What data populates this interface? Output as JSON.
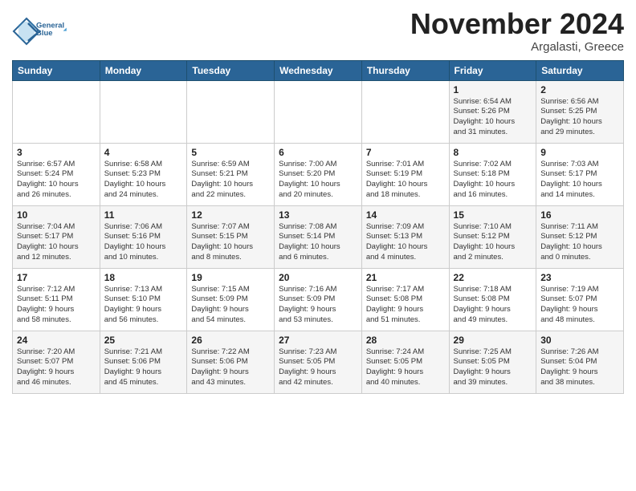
{
  "header": {
    "logo_line1": "General",
    "logo_line2": "Blue",
    "month": "November 2024",
    "location": "Argalasti, Greece"
  },
  "weekdays": [
    "Sunday",
    "Monday",
    "Tuesday",
    "Wednesday",
    "Thursday",
    "Friday",
    "Saturday"
  ],
  "weeks": [
    [
      {
        "day": "",
        "info": ""
      },
      {
        "day": "",
        "info": ""
      },
      {
        "day": "",
        "info": ""
      },
      {
        "day": "",
        "info": ""
      },
      {
        "day": "",
        "info": ""
      },
      {
        "day": "1",
        "info": "Sunrise: 6:54 AM\nSunset: 5:26 PM\nDaylight: 10 hours\nand 31 minutes."
      },
      {
        "day": "2",
        "info": "Sunrise: 6:56 AM\nSunset: 5:25 PM\nDaylight: 10 hours\nand 29 minutes."
      }
    ],
    [
      {
        "day": "3",
        "info": "Sunrise: 6:57 AM\nSunset: 5:24 PM\nDaylight: 10 hours\nand 26 minutes."
      },
      {
        "day": "4",
        "info": "Sunrise: 6:58 AM\nSunset: 5:23 PM\nDaylight: 10 hours\nand 24 minutes."
      },
      {
        "day": "5",
        "info": "Sunrise: 6:59 AM\nSunset: 5:21 PM\nDaylight: 10 hours\nand 22 minutes."
      },
      {
        "day": "6",
        "info": "Sunrise: 7:00 AM\nSunset: 5:20 PM\nDaylight: 10 hours\nand 20 minutes."
      },
      {
        "day": "7",
        "info": "Sunrise: 7:01 AM\nSunset: 5:19 PM\nDaylight: 10 hours\nand 18 minutes."
      },
      {
        "day": "8",
        "info": "Sunrise: 7:02 AM\nSunset: 5:18 PM\nDaylight: 10 hours\nand 16 minutes."
      },
      {
        "day": "9",
        "info": "Sunrise: 7:03 AM\nSunset: 5:17 PM\nDaylight: 10 hours\nand 14 minutes."
      }
    ],
    [
      {
        "day": "10",
        "info": "Sunrise: 7:04 AM\nSunset: 5:17 PM\nDaylight: 10 hours\nand 12 minutes."
      },
      {
        "day": "11",
        "info": "Sunrise: 7:06 AM\nSunset: 5:16 PM\nDaylight: 10 hours\nand 10 minutes."
      },
      {
        "day": "12",
        "info": "Sunrise: 7:07 AM\nSunset: 5:15 PM\nDaylight: 10 hours\nand 8 minutes."
      },
      {
        "day": "13",
        "info": "Sunrise: 7:08 AM\nSunset: 5:14 PM\nDaylight: 10 hours\nand 6 minutes."
      },
      {
        "day": "14",
        "info": "Sunrise: 7:09 AM\nSunset: 5:13 PM\nDaylight: 10 hours\nand 4 minutes."
      },
      {
        "day": "15",
        "info": "Sunrise: 7:10 AM\nSunset: 5:12 PM\nDaylight: 10 hours\nand 2 minutes."
      },
      {
        "day": "16",
        "info": "Sunrise: 7:11 AM\nSunset: 5:12 PM\nDaylight: 10 hours\nand 0 minutes."
      }
    ],
    [
      {
        "day": "17",
        "info": "Sunrise: 7:12 AM\nSunset: 5:11 PM\nDaylight: 9 hours\nand 58 minutes."
      },
      {
        "day": "18",
        "info": "Sunrise: 7:13 AM\nSunset: 5:10 PM\nDaylight: 9 hours\nand 56 minutes."
      },
      {
        "day": "19",
        "info": "Sunrise: 7:15 AM\nSunset: 5:09 PM\nDaylight: 9 hours\nand 54 minutes."
      },
      {
        "day": "20",
        "info": "Sunrise: 7:16 AM\nSunset: 5:09 PM\nDaylight: 9 hours\nand 53 minutes."
      },
      {
        "day": "21",
        "info": "Sunrise: 7:17 AM\nSunset: 5:08 PM\nDaylight: 9 hours\nand 51 minutes."
      },
      {
        "day": "22",
        "info": "Sunrise: 7:18 AM\nSunset: 5:08 PM\nDaylight: 9 hours\nand 49 minutes."
      },
      {
        "day": "23",
        "info": "Sunrise: 7:19 AM\nSunset: 5:07 PM\nDaylight: 9 hours\nand 48 minutes."
      }
    ],
    [
      {
        "day": "24",
        "info": "Sunrise: 7:20 AM\nSunset: 5:07 PM\nDaylight: 9 hours\nand 46 minutes."
      },
      {
        "day": "25",
        "info": "Sunrise: 7:21 AM\nSunset: 5:06 PM\nDaylight: 9 hours\nand 45 minutes."
      },
      {
        "day": "26",
        "info": "Sunrise: 7:22 AM\nSunset: 5:06 PM\nDaylight: 9 hours\nand 43 minutes."
      },
      {
        "day": "27",
        "info": "Sunrise: 7:23 AM\nSunset: 5:05 PM\nDaylight: 9 hours\nand 42 minutes."
      },
      {
        "day": "28",
        "info": "Sunrise: 7:24 AM\nSunset: 5:05 PM\nDaylight: 9 hours\nand 40 minutes."
      },
      {
        "day": "29",
        "info": "Sunrise: 7:25 AM\nSunset: 5:05 PM\nDaylight: 9 hours\nand 39 minutes."
      },
      {
        "day": "30",
        "info": "Sunrise: 7:26 AM\nSunset: 5:04 PM\nDaylight: 9 hours\nand 38 minutes."
      }
    ]
  ]
}
